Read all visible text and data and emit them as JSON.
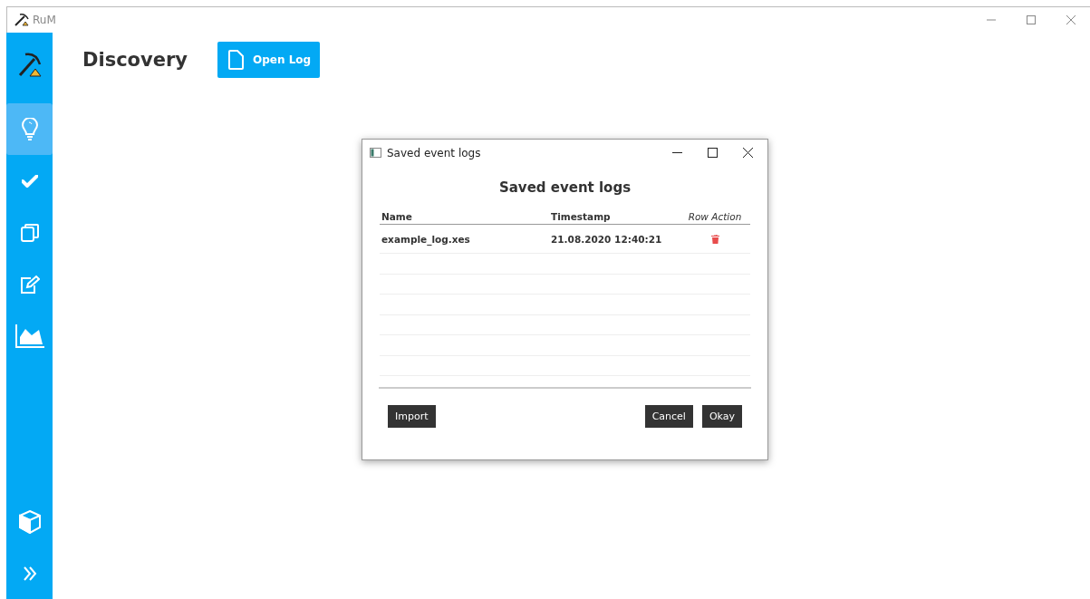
{
  "window": {
    "title": "RuM"
  },
  "sidebar": {
    "items": [
      {
        "kind": "bulb",
        "selected": true
      },
      {
        "kind": "check",
        "selected": false
      },
      {
        "kind": "copy",
        "selected": false
      },
      {
        "kind": "edit",
        "selected": false
      },
      {
        "kind": "chart",
        "selected": false
      }
    ],
    "bottom_items": [
      {
        "kind": "cube"
      },
      {
        "kind": "expand"
      }
    ]
  },
  "page": {
    "heading": "Discovery",
    "open_button": "Open Log"
  },
  "dialog": {
    "title": "Saved event logs",
    "heading": "Saved event logs",
    "columns": [
      "Name",
      "Timestamp",
      "Row Action"
    ],
    "rows": [
      {
        "name": "example_log.xes",
        "timestamp": "21.08.2020 12:40:21"
      }
    ],
    "buttons_left": [
      "Import"
    ],
    "buttons_right": [
      "Cancel",
      "Okay"
    ]
  }
}
